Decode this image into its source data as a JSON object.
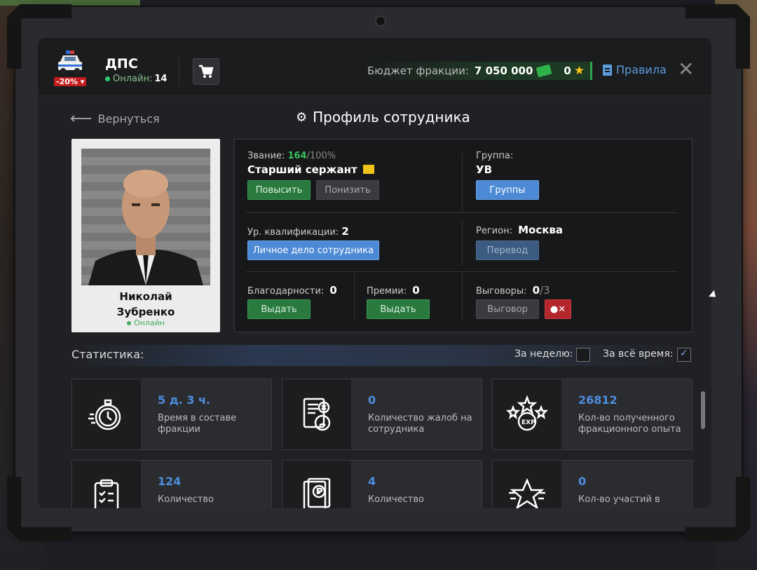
{
  "header": {
    "faction_title": "ДПС",
    "online_label": "Онлайн:",
    "online_count": "14",
    "discount": "-20%",
    "budget_label": "Бюджет фракции:",
    "budget_value": "7 050 000",
    "stars_value": "0",
    "rules_label": "Правила",
    "accent_green": "#2fa44f",
    "accent_blue": "#5b9bdc"
  },
  "nav": {
    "back_label": "Вернуться",
    "page_title": "Профиль сотрудника"
  },
  "person": {
    "first_name": "Николай",
    "last_name": "Зубренко",
    "status": "Онлайн"
  },
  "info": {
    "rank_label": "Звание:",
    "rank_progress": "164",
    "rank_progress_max": "/100%",
    "rank_name": "Старший сержант",
    "promote_btn": "Повысить",
    "demote_btn": "Понизить",
    "group_label": "Группа:",
    "group_value": "УВ",
    "groups_btn": "Группы",
    "qual_label": "Ур. квалификации:",
    "qual_value": "2",
    "file_btn": "Личное дело сотрудника",
    "region_label": "Регион:",
    "region_value": "Москва",
    "transfer_btn": "Перевод",
    "thanks_label": "Благодарности:",
    "thanks_value": "0",
    "thanks_btn": "Выдать",
    "bonus_label": "Премии:",
    "bonus_value": "0",
    "bonus_btn": "Выдать",
    "reprimand_label": "Выговоры:",
    "reprimand_value": "0",
    "reprimand_max": "/3",
    "reprimand_btn": "Выговор"
  },
  "stats": {
    "title": "Статистика:",
    "week_label": "За неделю:",
    "week_checked": false,
    "all_label": "За всё время:",
    "all_checked": true,
    "cards": [
      {
        "value": "5 д. 3 ч.",
        "desc": "Время в составе фракции",
        "icon": "stopwatch-icon"
      },
      {
        "value": "0",
        "desc": "Количество жалоб на сотрудника",
        "icon": "complaint-icon"
      },
      {
        "value": "26812",
        "desc": "Кол-во полученного фракционного опыта",
        "icon": "exp-stars-icon"
      },
      {
        "value": "124",
        "desc": "Количество",
        "icon": "clipboard-icon"
      },
      {
        "value": "4",
        "desc": "Количество",
        "icon": "ruble-doc-icon"
      },
      {
        "value": "0",
        "desc": "Кол-во участий в",
        "icon": "star-icon"
      }
    ]
  }
}
